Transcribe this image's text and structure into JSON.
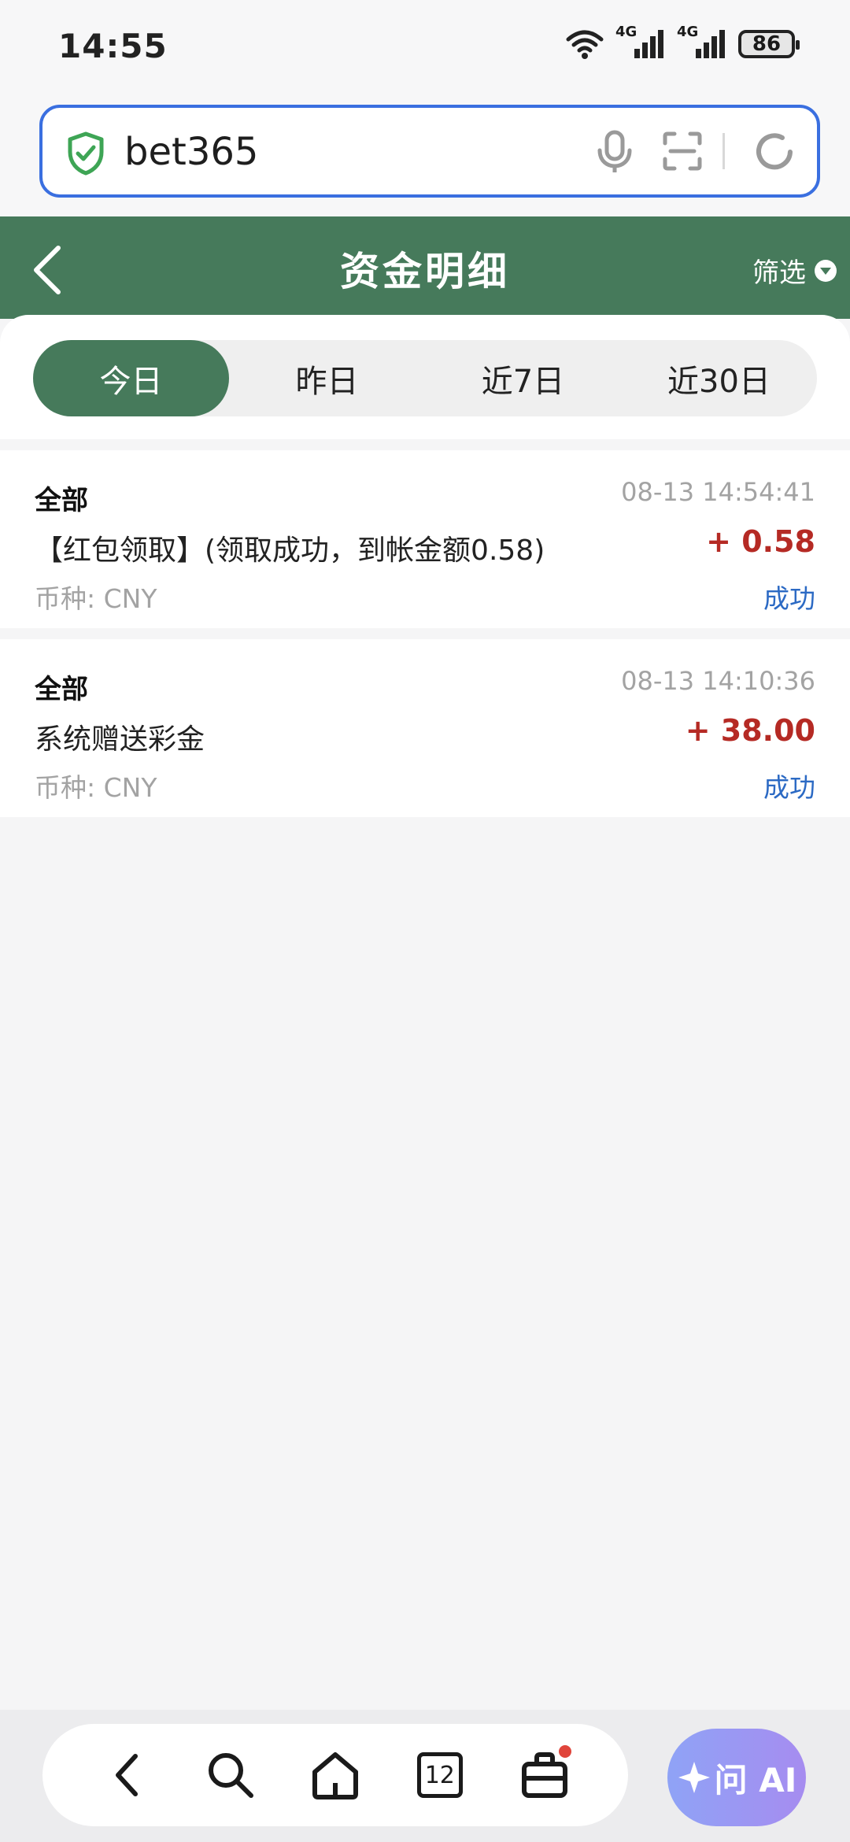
{
  "status_bar": {
    "time": "14:55",
    "network_1": "4G",
    "network_2": "4G",
    "battery": "86"
  },
  "url_bar": {
    "url": "bet365"
  },
  "header": {
    "title": "资金明细",
    "filter_label": "筛选"
  },
  "tabs": [
    {
      "label": "今日",
      "active": true
    },
    {
      "label": "昨日",
      "active": false
    },
    {
      "label": "近7日",
      "active": false
    },
    {
      "label": "近30日",
      "active": false
    }
  ],
  "records": [
    {
      "category": "全部",
      "timestamp": "08-13 14:54:41",
      "description": "【红包领取】(领取成功，到帐金额0.58)",
      "amount": "+ 0.58",
      "currency": "币种: CNY",
      "status": "成功"
    },
    {
      "category": "全部",
      "timestamp": "08-13 14:10:36",
      "description": "系统赠送彩金",
      "amount": "+ 38.00",
      "currency": "币种: CNY",
      "status": "成功"
    }
  ],
  "bottom_nav": {
    "tabs_count": "12",
    "ai_label": "问 AI"
  },
  "colors": {
    "header_green": "#467a5b",
    "amount_red": "#b52a24",
    "status_blue": "#2c6ac4",
    "url_border": "#3a6fe0"
  }
}
